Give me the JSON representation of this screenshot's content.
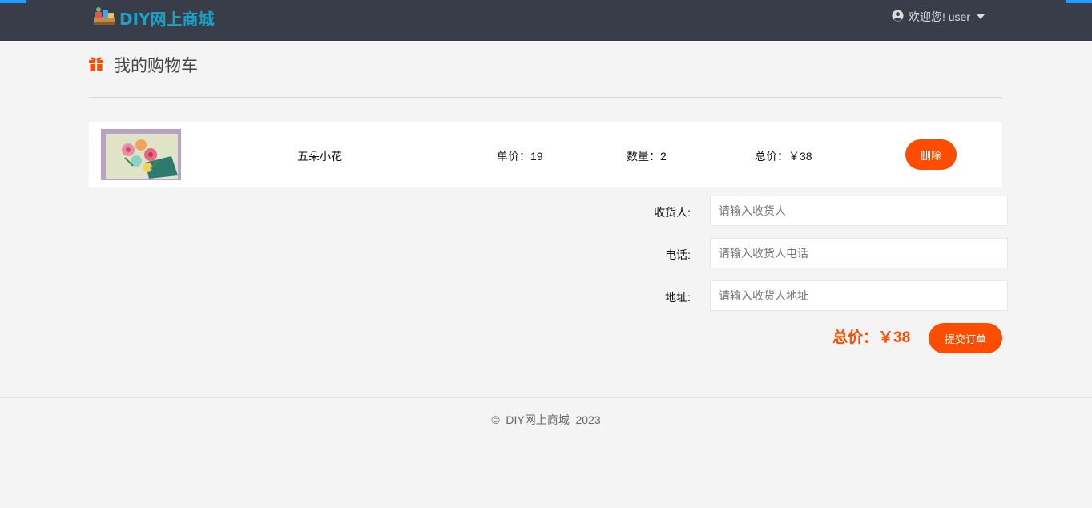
{
  "header": {
    "logo_text": "DIY网上商城",
    "user_greeting": "欢迎您! user"
  },
  "page": {
    "title": "我的购物车"
  },
  "cart": {
    "items": [
      {
        "name": "五朵小花",
        "unit_price_label": "单价：19",
        "quantity_label": "数量：2",
        "subtotal_label": "总价：￥38",
        "delete_label": "删除"
      }
    ]
  },
  "form": {
    "receiver_label": "收货人:",
    "receiver_placeholder": "请输入收货人",
    "phone_label": "电话:",
    "phone_placeholder": "请输入收货人电话",
    "address_label": "地址:",
    "address_placeholder": "请输入收货人地址"
  },
  "summary": {
    "total_label": "总价：￥38",
    "submit_label": "提交订单"
  },
  "footer": {
    "text": "©  DIY网上商城  2023"
  },
  "colors": {
    "topbar": "#393d49",
    "accent": "#ff4d00",
    "logo": "#1aa3c9",
    "corner": "#1e9fff"
  },
  "icons": {
    "logo": "diy-logo-icon",
    "user": "user-circle-icon",
    "gift": "gift-icon"
  }
}
